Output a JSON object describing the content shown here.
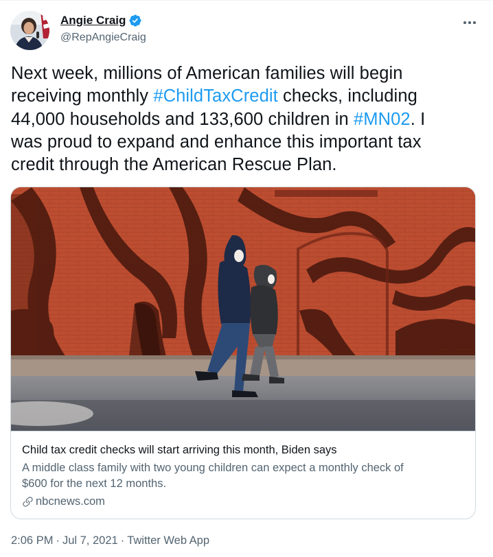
{
  "author": {
    "display_name": "Angie Craig",
    "handle": "@RepAngieCraig",
    "verified": true
  },
  "menu_icon": "more-horizontal-icon",
  "tweet": {
    "line1": "Next week, millions of American families will begin",
    "line2_pre": "receiving monthly ",
    "hashtag1": "#ChildTaxCredit",
    "line2_post": " checks, including",
    "line3_pre": "44,000 households and 133,600 children in ",
    "hashtag2": "#MN02",
    "line3_post": ". I",
    "line4": "was proud to expand and enhance this important tax",
    "line5": "credit through the American Rescue Plan."
  },
  "card": {
    "title": "Child tax credit checks will start arriving this month, Biden says",
    "desc_line1": "A middle class family with two young children can expect a monthly check of",
    "desc_line2": "$600 for the next 12 months.",
    "domain": "nbcnews.com",
    "domain_icon": "link-icon"
  },
  "meta": {
    "time": "2:06 PM",
    "date": "Jul 7, 2021",
    "source": "Twitter Web App",
    "separator": "·"
  },
  "colors": {
    "link": "#1d9bf0",
    "secondary_text": "#536471",
    "primary_text": "#0f1419",
    "border": "#cfd9de"
  }
}
